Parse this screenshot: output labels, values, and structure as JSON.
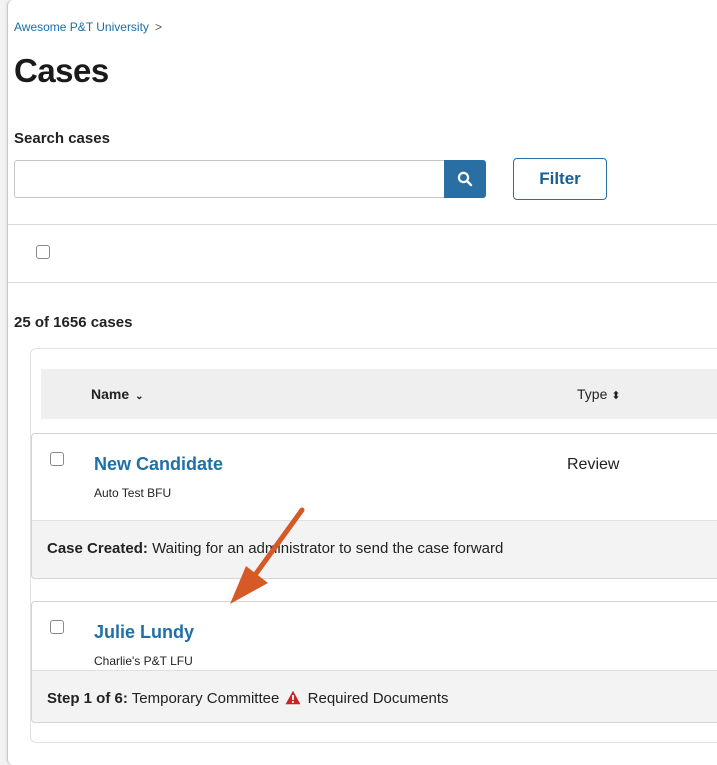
{
  "breadcrumb": {
    "link": "Awesome P&T University",
    "separator": ">"
  },
  "page": {
    "title": "Cases"
  },
  "search": {
    "label": "Search cases",
    "value": "",
    "placeholder": "",
    "button_icon": "search-icon"
  },
  "filter": {
    "label": "Filter"
  },
  "summary": {
    "count_text": "25 of 1656 cases"
  },
  "table": {
    "columns": [
      {
        "label": "Name",
        "sort_icon": "sort-down-icon",
        "sort_glyph": "⌄"
      },
      {
        "label": "Type",
        "sort_icon": "sort-both-icon",
        "sort_glyph": "⬍"
      }
    ]
  },
  "cases": [
    {
      "name": "New Candidate",
      "unit": "Auto Test BFU",
      "type": "Review",
      "status_label": "Case Created:",
      "status_text": "Waiting for an administrator to send the case forward"
    },
    {
      "name": "Julie Lundy",
      "unit": "Charlie's P&T LFU",
      "type": "",
      "status_label": "Step 1 of 6:",
      "status_text": "Temporary Committee",
      "warning_icon": "warning-icon",
      "warning_text": "Required Documents"
    }
  ],
  "colors": {
    "link": "#1f6fa8",
    "primary_button": "#2a6fa3",
    "warning": "#cc2222",
    "annotation_arrow": "#d65a28"
  }
}
